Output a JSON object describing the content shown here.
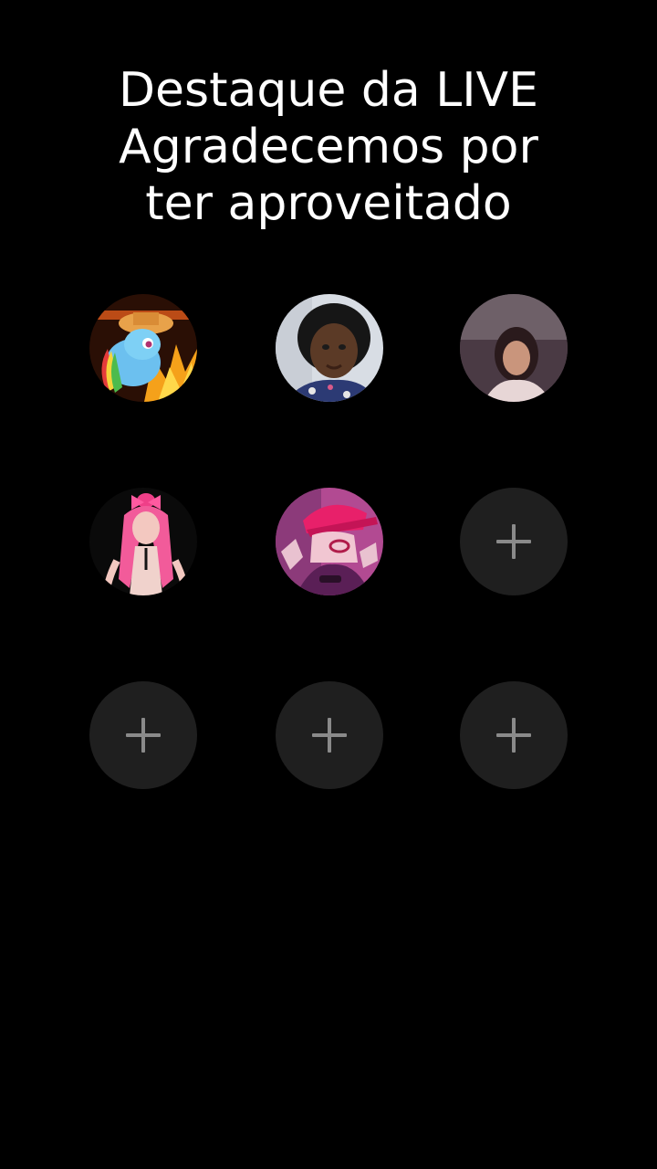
{
  "title": {
    "line1": "Destaque da LIVE",
    "line2": "Agradecemos por",
    "line3": "ter aproveitado"
  },
  "slots": [
    {
      "kind": "avatar",
      "icon": "pony-avatar"
    },
    {
      "kind": "avatar",
      "icon": "girl-avatar"
    },
    {
      "kind": "avatar",
      "icon": "girl-avatar"
    },
    {
      "kind": "avatar",
      "icon": "pink-hair-avatar"
    },
    {
      "kind": "avatar",
      "icon": "pink-cap-avatar"
    },
    {
      "kind": "empty",
      "icon": "plus-icon"
    },
    {
      "kind": "empty",
      "icon": "plus-icon"
    },
    {
      "kind": "empty",
      "icon": "plus-icon"
    },
    {
      "kind": "empty",
      "icon": "plus-icon"
    }
  ],
  "colors": {
    "background": "#000000",
    "title": "#ffffff",
    "empty_slot": "#1f1f1f",
    "plus": "#8a8a8a"
  }
}
